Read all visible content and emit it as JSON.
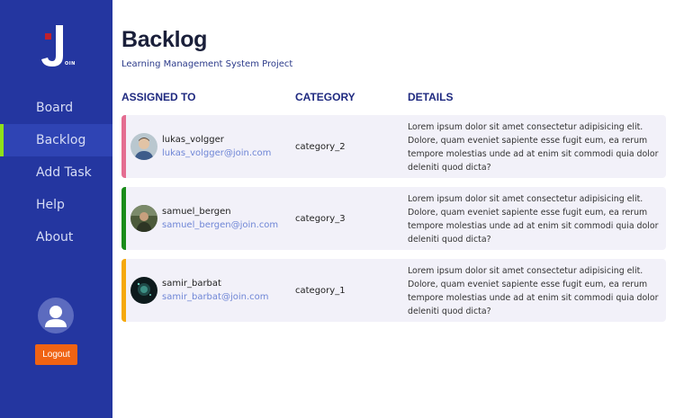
{
  "sidebar": {
    "logo_letters": "OIN",
    "nav": [
      {
        "label": "Board",
        "active": false
      },
      {
        "label": "Backlog",
        "active": true
      },
      {
        "label": "Add Task",
        "active": false
      },
      {
        "label": "Help",
        "active": false
      },
      {
        "label": "About",
        "active": false
      }
    ],
    "logout_label": "Logout",
    "colors": {
      "background": "#2436a0",
      "active_indicator": "#8fe11a",
      "logout": "#f06313"
    }
  },
  "main": {
    "title": "Backlog",
    "subtitle": "Learning Management System Project",
    "columns": [
      "ASSIGNED TO",
      "CATEGORY",
      "DETAILS"
    ],
    "rows": [
      {
        "username": "lukas_volgger",
        "email": "lukas_volgger@join.com",
        "category": "category_2",
        "details": "Lorem ipsum dolor sit amet consectetur adipisicing elit. Dolore, quam eveniet sapiente esse fugit eum, ea rerum tempore molestias unde ad at enim sit commodi quia dolor deleniti quod dicta?",
        "accent": "#e46d91",
        "avatar_icon": "man-portrait-avatar"
      },
      {
        "username": "samuel_bergen",
        "email": "samuel_bergen@join.com",
        "category": "category_3",
        "details": "Lorem ipsum dolor sit amet consectetur adipisicing elit. Dolore, quam eveniet sapiente esse fugit eum, ea rerum tempore molestias unde ad at enim sit commodi quia dolor deleniti quod dicta?",
        "accent": "#1a8c1a",
        "avatar_icon": "outdoor-portrait-avatar"
      },
      {
        "username": "samir_barbat",
        "email": "samir_barbat@join.com",
        "category": "category_1",
        "details": "Lorem ipsum dolor sit amet consectetur adipisicing elit. Dolore, quam eveniet sapiente esse fugit eum, ea rerum tempore molestias unde ad at enim sit commodi quia dolor deleniti quod dicta?",
        "accent": "#f5a90d",
        "avatar_icon": "dark-portrait-avatar"
      }
    ]
  }
}
